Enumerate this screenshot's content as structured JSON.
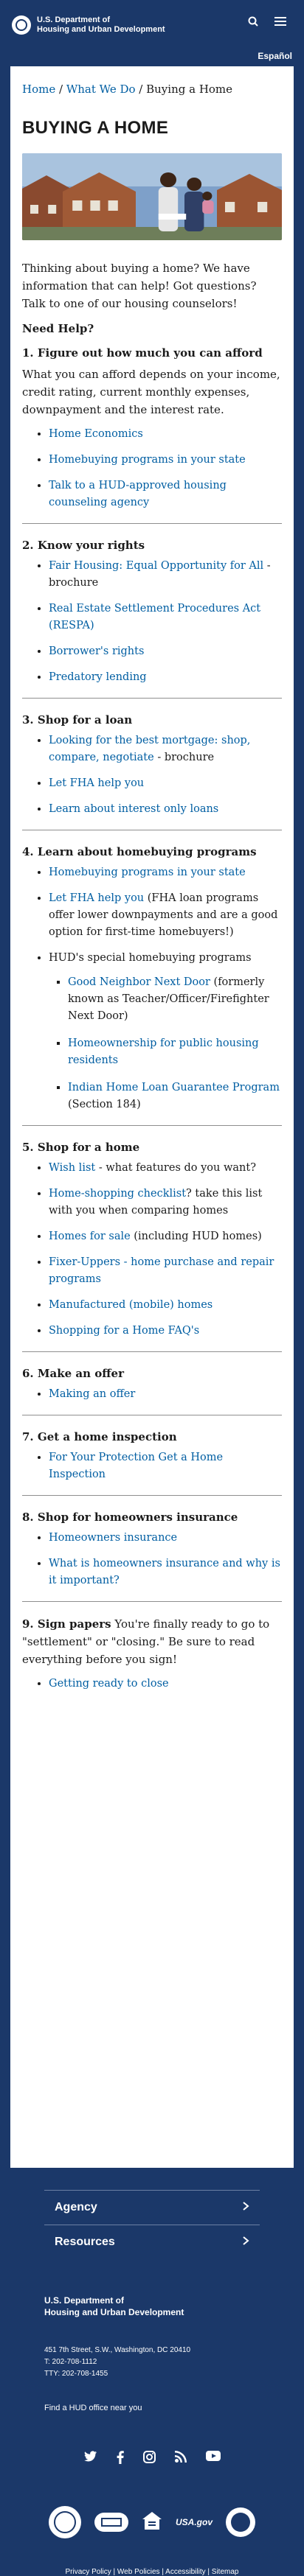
{
  "header": {
    "agency_line1": "U.S. Department of",
    "agency_line2": "Housing and Urban Development",
    "language_link": "Español"
  },
  "breadcrumb": {
    "home": "Home",
    "sep1": " / ",
    "what_we_do": "What We Do",
    "sep2": " / ",
    "current": "Buying a Home"
  },
  "title": "BUYING A HOME",
  "intro": "Thinking about buying a home? We have information that can help! Got questions? Talk to one of our housing counselors!",
  "need_help": "Need Help?",
  "sections": {
    "s1": {
      "heading": "1. Figure out how much you can afford",
      "body": "What you can afford depends on your income, credit rating, current monthly expenses, downpayment and the interest rate.",
      "links": [
        "Home Economics",
        "Homebuying programs in your state",
        "Talk to a HUD-approved housing counseling agency"
      ]
    },
    "s2": {
      "heading": "2. Know your rights",
      "item1_link": "Fair Housing: Equal Opportunity for All",
      "item1_suffix": " - brochure",
      "item2_link": "Real Estate Settlement Procedures Act (RESPA)",
      "item3_link": "Borrower's rights",
      "item4_link": "Predatory lending"
    },
    "s3": {
      "heading": "3. Shop for a loan",
      "item1_link": "Looking for the best mortgage: shop, compare, negotiate",
      "item1_suffix": " - brochure",
      "item2_link": "Let FHA help you",
      "item3_link": "Learn about interest only loans"
    },
    "s4": {
      "heading": "4. Learn about homebuying programs",
      "item1_link": "Homebuying programs in your state",
      "item2_link": "Let FHA help you",
      "item2_suffix": " (FHA loan programs offer lower downpayments and are a good option for first-time homebuyers!)",
      "item3_text": "HUD's special homebuying programs",
      "sub1_link": "Good Neighbor Next Door",
      "sub1_suffix": " (formerly known as Teacher/Officer/Firefighter Next Door)",
      "sub2_link": "Homeownership for public housing residents",
      "sub3_link": "Indian Home Loan Guarantee Program",
      "sub3_suffix": " (Section 184)"
    },
    "s5": {
      "heading": "5. Shop for a home",
      "item1_link": "Wish list",
      "item1_suffix": " - what features do you want?",
      "item2_link": "Home-shopping checklist",
      "item2_suffix": "? take this list with you when comparing homes",
      "item3_link": "Homes for sale",
      "item3_suffix": " (including HUD homes)",
      "item4_link": "Fixer-Uppers - home purchase and repair programs",
      "item5_link": "Manufactured (mobile) homes",
      "item6_link": "Shopping for a Home FAQ's"
    },
    "s6": {
      "heading": "6. Make an offer",
      "item1_link": "Making an offer"
    },
    "s7": {
      "heading": "7. Get a home inspection",
      "item1_link": "For Your Protection Get a Home Inspection"
    },
    "s8": {
      "heading": "8. Shop for homeowners insurance",
      "item1_link": "Homeowners insurance",
      "item2_link": "What is homeowners insurance and why is it important?"
    },
    "s9": {
      "heading": "9. Sign papers",
      "body": " You're finally ready to go to \"settlement\" or \"closing.\" Be sure to read everything before you sign!",
      "item1_link": "Getting ready to close"
    }
  },
  "footer": {
    "accordion1": "Agency",
    "accordion2": "Resources",
    "agency_line1": "U.S. Department of",
    "agency_line2": "Housing and Urban Development",
    "address": "451 7th Street, S.W., Washington, DC 20410",
    "phone": "T: 202-708-1112",
    "tty": "TTY: 202-708-1455",
    "find_office": "Find a HUD office near you",
    "social_icons": [
      "twitter-icon",
      "facebook-icon",
      "instagram-icon",
      "rss-icon",
      "youtube-icon"
    ],
    "logo_usagov": "USA.gov",
    "links": [
      "Privacy Policy",
      "Web Policies",
      "Accessibility",
      "Sitemap"
    ],
    "separator": " | "
  },
  "colors": {
    "navy": "#1b3869",
    "link": "#005ea2"
  }
}
